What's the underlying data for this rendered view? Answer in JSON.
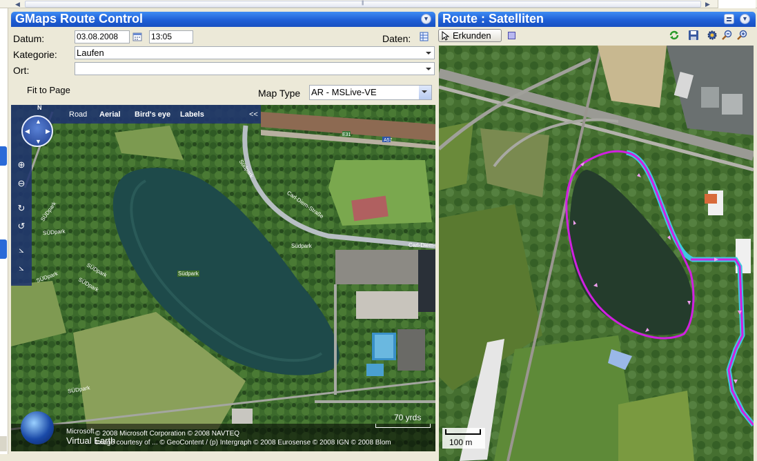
{
  "left_panel": {
    "title": "GMaps Route Control",
    "datum_label": "Datum:",
    "datum_value": "03.08.2008",
    "time_value": "13:05",
    "daten_label": "Daten:",
    "kategorie_label": "Kategorie:",
    "kategorie_value": "Laufen",
    "ort_label": "Ort:",
    "ort_value": "",
    "fit_to_page": "Fit to Page",
    "map_type_label": "Map Type",
    "map_type_value": "AR - MSLive-VE"
  },
  "left_map": {
    "nav_modes": [
      "Road",
      "Aerial",
      "Bird's eye",
      "Labels"
    ],
    "collapse": "<<",
    "compass_north": "N",
    "labels": {
      "lake": "Südpark",
      "park1": "Südpark",
      "park2": "SÜDpark",
      "park3": "SÜDpark",
      "park4": "SÜDpark",
      "park5": "SÜDpark",
      "park6": "SÜDpark",
      "park7": "SÜDpark",
      "park8": "Südpark",
      "street1": "Carl-Diem-Straße",
      "street2": "Carl-Diem-",
      "road1": "E31",
      "road2": "A57"
    },
    "scale": "70 yrds",
    "brand_line1": "Microsoft",
    "brand_line2": "Virtual Earth",
    "copyright1": "© 2008 Microsoft Corporation  © 2008 NAVTEQ",
    "copyright2": "Image courtesy of ... © GeoContent / (p) Intergraph  © 2008 Eurosense  © 2008 IGN  © 2008 Blom"
  },
  "right_panel": {
    "title": "Route : Satelliten",
    "explore_button": "Erkunden",
    "scale": "100 m"
  },
  "colors": {
    "header_blue": "#1f5fd6",
    "route_magenta": "#d020e0",
    "route_cyan": "#40c8e0"
  }
}
